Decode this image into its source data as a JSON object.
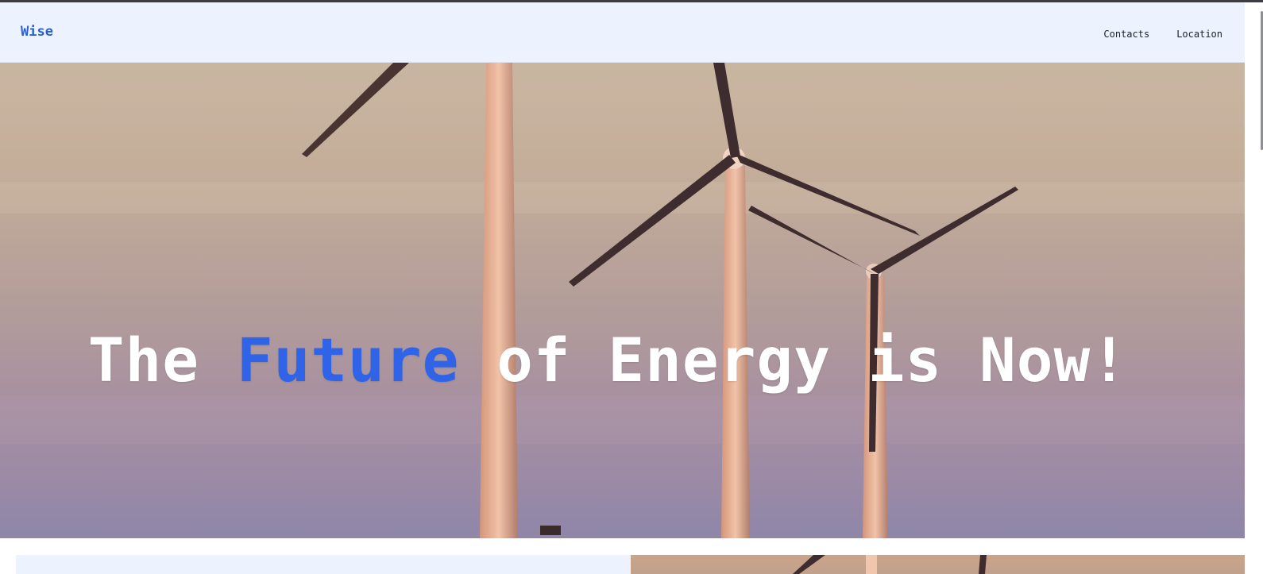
{
  "navbar": {
    "logo": "Wise",
    "links": [
      "Contacts",
      "Location"
    ]
  },
  "hero": {
    "title_before": "The",
    "title_accent": "Future",
    "title_after": "of Energy is Now!",
    "image": "wind-turbines-photo"
  },
  "lower_section": {
    "image": "wind-turbines-photo"
  },
  "colors": {
    "accent": "#2f63e8",
    "navbar_bg": "#ecf3fe",
    "logo": "#2b5fd0"
  }
}
